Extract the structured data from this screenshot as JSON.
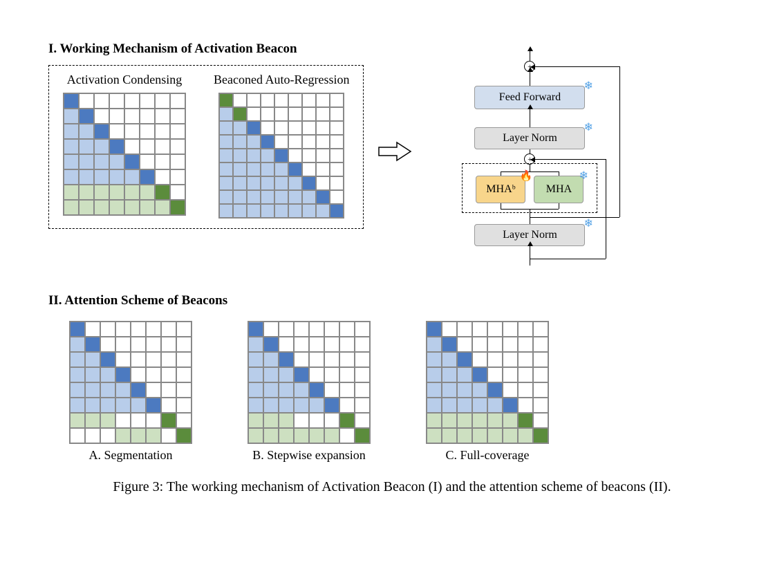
{
  "section1_title": "I. Working Mechanism of Activation Beacon",
  "section2_title": "II. Attention Scheme of Beacons",
  "matrix_labels": {
    "ac": "Activation Condensing",
    "bar": "Beaconed Auto-Regression"
  },
  "arch": {
    "ff": "Feed Forward",
    "ln": "Layer Norm",
    "mhab": "MHAᵇ",
    "mha": "MHA"
  },
  "schemes": {
    "a": "A. Segmentation",
    "b": "B. Stepwise expansion",
    "c": "C. Full-coverage"
  },
  "caption": "Figure 3: The working mechanism of Activation Beacon (I) and the attention scheme of beacons (II).",
  "chart_data": [
    {
      "type": "heatmap",
      "name": "activation_condensing",
      "size": [
        8,
        8
      ],
      "legend": {
        "db": "diagonal-token",
        "lb": "attended-token",
        "dg": "diagonal-beacon",
        "lg": "attended-beacon",
        "white": "masked"
      },
      "rows": [
        "db . . . . . . .",
        "lb db . . . . . .",
        "lb lb db . . . . .",
        "lb lb lb db . . . .",
        "lb lb lb lb db . . .",
        "lb lb lb lb lb db . .",
        "lg lg lg lg lg lg dg .",
        "lg lg lg lg lg lg lg dg"
      ]
    },
    {
      "type": "heatmap",
      "name": "beaconed_auto_regression",
      "size": [
        9,
        9
      ],
      "rows": [
        "dg . . . . . . . .",
        "lb dg . . . . . . .",
        "lb lb db . . . . . .",
        "lb lb lb db . . . . .",
        "lb lb lb lb db . . . .",
        "lb lb lb lb lb db . . .",
        "lb lb lb lb lb lb db . .",
        "lb lb lb lb lb lb lb db .",
        "lb lb lb lb lb lb lb lb db"
      ]
    },
    {
      "type": "heatmap",
      "name": "segmentation",
      "size": [
        8,
        8
      ],
      "rows": [
        "db . . . . . . .",
        "lb db . . . . . .",
        "lb lb db . . . . .",
        "lb lb lb db . . . .",
        "lb lb lb lb db . . .",
        "lb lb lb lb lb db . .",
        "lg lg lg . . . dg .",
        ". . . lg lg lg . dg"
      ]
    },
    {
      "type": "heatmap",
      "name": "stepwise_expansion",
      "size": [
        8,
        8
      ],
      "rows": [
        "db . . . . . . .",
        "lb db . . . . . .",
        "lb lb db . . . . .",
        "lb lb lb db . . . .",
        "lb lb lb lb db . . .",
        "lb lb lb lb lb db . .",
        "lg lg lg . . . dg .",
        "lg lg lg lg lg lg . dg"
      ]
    },
    {
      "type": "heatmap",
      "name": "full_coverage",
      "size": [
        8,
        8
      ],
      "rows": [
        "db . . . . . . .",
        "lb db . . . . . .",
        "lb lb db . . . . .",
        "lb lb lb db . . . .",
        "lb lb lb lb db . . .",
        "lb lb lb lb lb db . .",
        "lg lg lg lg lg lg dg .",
        "lg lg lg lg lg lg lg dg"
      ]
    }
  ]
}
